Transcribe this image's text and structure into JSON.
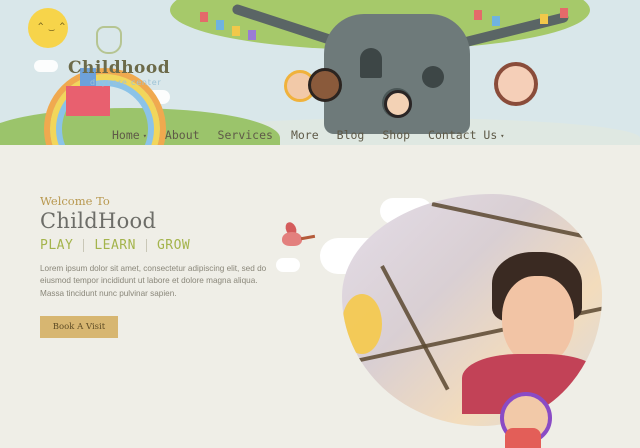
{
  "logo": {
    "title": "Childhood",
    "subtitle": "daycare center"
  },
  "nav": {
    "items": [
      {
        "label": "Home",
        "has_dropdown": true
      },
      {
        "label": "About",
        "has_dropdown": false
      },
      {
        "label": "Services",
        "has_dropdown": false
      },
      {
        "label": "More",
        "has_dropdown": false
      },
      {
        "label": "Blog",
        "has_dropdown": false
      },
      {
        "label": "Shop",
        "has_dropdown": false
      },
      {
        "label": "Contact Us",
        "has_dropdown": true
      }
    ],
    "caret": "▾"
  },
  "hero": {
    "welcome": "Welcome To",
    "title": "ChildHood",
    "taglines": [
      "PLAY",
      "LEARN",
      "GROW"
    ],
    "body": "Lorem ipsum dolor sit amet, consectetur adipiscing elit, sed do eiusmod tempor incididunt ut labore et dolore magna aliqua. Massa tincidunt nunc pulvinar sapien.",
    "button_label": "Book A Visit"
  },
  "colors": {
    "page_bg": "#efeee7",
    "accent_gold": "#d7b671",
    "accent_green": "#a4b44c",
    "heading_gray": "#6d6d68"
  },
  "icons": [
    "sun-icon",
    "hand-logo-icon",
    "bird-icon",
    "cloud-icon"
  ]
}
